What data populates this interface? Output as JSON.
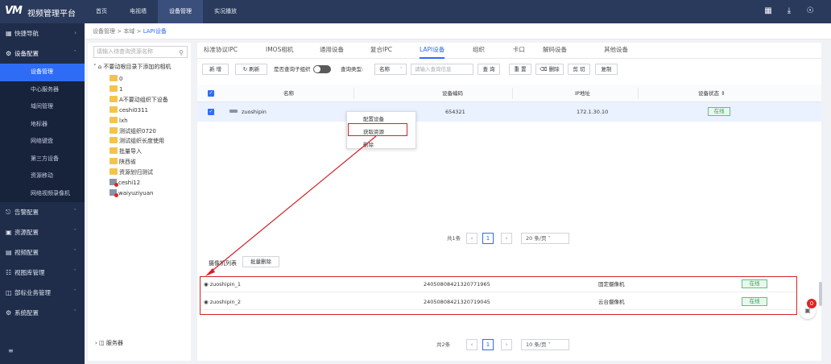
{
  "app": {
    "logo": "VM",
    "title": "视频管理平台"
  },
  "topnav": [
    "首页",
    "电视墙",
    "设备管理",
    "实况播放"
  ],
  "topnav_active": 2,
  "top_icons": [
    "grid-icon",
    "download-icon",
    "user-icon"
  ],
  "sidebar": {
    "groups": [
      {
        "label": "快捷导航",
        "icon": "grid-icon"
      },
      {
        "label": "设备配置",
        "icon": "gear-icon"
      }
    ],
    "subitems": [
      "设备管理",
      "中心服务器",
      "域间管理",
      "地标器",
      "网络键盘",
      "第三方设备",
      "资源移动",
      "网络视频录像机"
    ],
    "subitems_active": 0,
    "more_groups": [
      {
        "label": "告警配置",
        "icon": "alarm-icon"
      },
      {
        "label": "资源配置",
        "icon": "folder-icon"
      },
      {
        "label": "视频配置",
        "icon": "video-icon"
      },
      {
        "label": "视图库管理",
        "icon": "database-icon"
      },
      {
        "label": "部标业务管理",
        "icon": "briefcase-icon"
      },
      {
        "label": "系统配置",
        "icon": "settings-icon"
      }
    ]
  },
  "breadcrumb": {
    "part1": "设备管理",
    "sep": ">",
    "part2": "本域",
    "part3": "LAPI设备"
  },
  "tree": {
    "search_placeholder": "请输入待查询资源名称",
    "root": "不要动根目录下添加的相机",
    "items": [
      {
        "label": "0",
        "type": "folder"
      },
      {
        "label": "1",
        "type": "folder"
      },
      {
        "label": "A不要动组织下设备",
        "type": "folder"
      },
      {
        "label": "ceshi0311",
        "type": "folder"
      },
      {
        "label": "lxh",
        "type": "folder"
      },
      {
        "label": "测试组织0720",
        "type": "folder"
      },
      {
        "label": "测试组织长度使用",
        "type": "folder"
      },
      {
        "label": "批量导入",
        "type": "folder"
      },
      {
        "label": "陕西省",
        "type": "folder"
      },
      {
        "label": "资源划归测试",
        "type": "folder"
      },
      {
        "label": "ceshi12",
        "type": "device"
      },
      {
        "label": "waiyuziyuan",
        "type": "device"
      }
    ],
    "server": "服务器"
  },
  "tabs": [
    "标准协议IPC",
    "IMOS相机",
    "通用设备",
    "复合IPC",
    "LAPI设备",
    "组织",
    "卡口",
    "解码设备",
    "其他设备"
  ],
  "tabs_active": 4,
  "toolbar": {
    "new": "新 增",
    "refresh": "刷新",
    "include_sub": "是否查询子组织",
    "query_type": "查询类型:",
    "query_select": "名称",
    "query_placeholder": "请输入查询信息",
    "search": "查 询",
    "reset": "重 置",
    "delete": "删除",
    "cut": "剪 切",
    "copy": "复制"
  },
  "table": {
    "headers": [
      "名称",
      "设备编码",
      "IP地址",
      "设备状态"
    ],
    "rows": [
      {
        "name": "zuoshipin",
        "code": "654321",
        "ip": "172.1.30.10",
        "status": "在线"
      }
    ]
  },
  "context_menu": [
    "配置设备",
    "获取资源",
    "删除"
  ],
  "pager1": {
    "total": "共1条",
    "page": "1",
    "size": "20 条/页"
  },
  "camera_list": {
    "label": "摄像机列表",
    "batch_delete": "批量删除",
    "rows": [
      {
        "name": "zuoshipin_1",
        "code": "24050808421320771965",
        "type": "固定摄像机",
        "status": "在线"
      },
      {
        "name": "zuoshipin_2",
        "code": "24050808421320719045",
        "type": "云台摄像机",
        "status": "在线"
      }
    ]
  },
  "pager2": {
    "total": "共2条",
    "page": "1",
    "size": "10 条/页"
  },
  "float_badge": "0",
  "colors": {
    "accent": "#2e6cf6",
    "topbar": "#2a3a5c",
    "sidebar": "#1f2d4b",
    "highlight": "#d2232a",
    "online": "#2f9e56"
  }
}
